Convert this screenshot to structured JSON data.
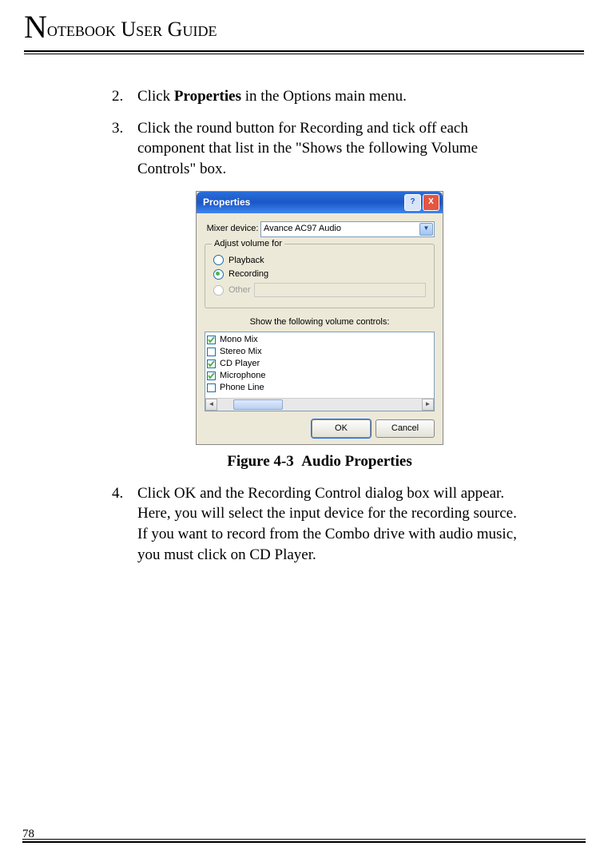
{
  "header": {
    "title_big": "N",
    "title_rest": "otebook User Guide"
  },
  "steps": {
    "s2": {
      "num": "2.",
      "pre": "Click ",
      "bold": "Properties",
      "post": " in the Options main menu."
    },
    "s3": {
      "num": "3.",
      "text": "Click the round button for Recording and tick off each component that list in the \"Shows the following Volume Controls\" box."
    },
    "s4": {
      "num": "4.",
      "text": "Click OK and the Recording Control dialog box will appear. Here, you will select the input device for the recording source. If you want to record from the Combo drive with audio music, you must click on CD Player."
    }
  },
  "figure": {
    "ref": "Figure 4-3",
    "title": "Audio Properties"
  },
  "dialog": {
    "title": "Properties",
    "mixer_label": "Mixer device:",
    "mixer_value": "Avance AC97 Audio",
    "group_label": "Adjust volume for",
    "radio_playback": "Playback",
    "radio_recording": "Recording",
    "radio_other": "Other",
    "section_label": "Show the following volume controls:",
    "items": [
      {
        "label": "Mono Mix",
        "checked": true
      },
      {
        "label": "Stereo Mix",
        "checked": false
      },
      {
        "label": "CD Player",
        "checked": true
      },
      {
        "label": "Microphone",
        "checked": true
      },
      {
        "label": "Phone Line",
        "checked": false
      }
    ],
    "ok": "OK",
    "cancel": "Cancel",
    "help": "?",
    "close": "X"
  },
  "page_number": "78"
}
